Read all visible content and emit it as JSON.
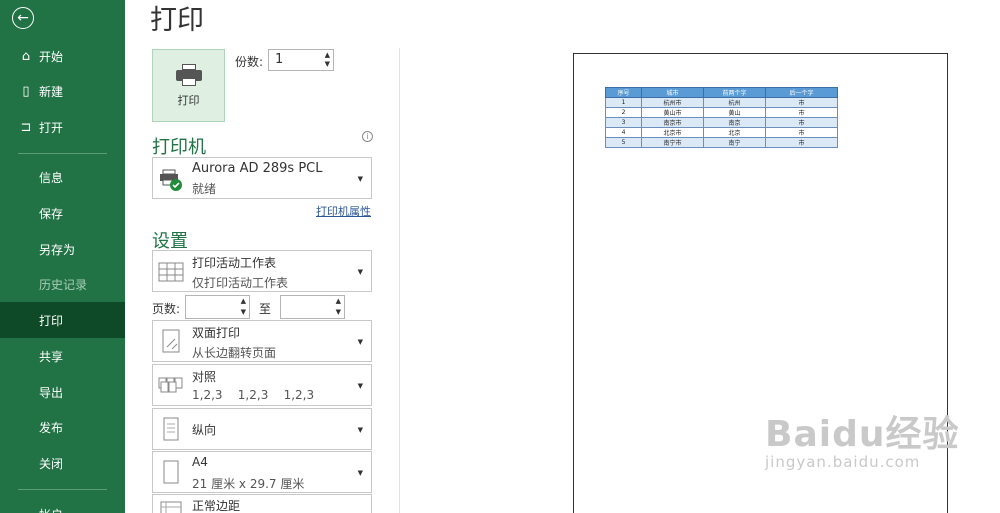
{
  "sidebar": {
    "items": [
      {
        "label": "开始",
        "icon": "home-icon"
      },
      {
        "label": "新建",
        "icon": "new-file-icon"
      },
      {
        "label": "打开",
        "icon": "open-folder-icon"
      },
      {
        "label": "信息"
      },
      {
        "label": "保存"
      },
      {
        "label": "另存为"
      },
      {
        "label": "历史记录",
        "disabled": true
      },
      {
        "label": "打印",
        "active": true
      },
      {
        "label": "共享"
      },
      {
        "label": "导出"
      },
      {
        "label": "发布"
      },
      {
        "label": "关闭"
      },
      {
        "label": "帐户"
      }
    ]
  },
  "page_title": "打印",
  "print_button": {
    "label": "打印"
  },
  "copies": {
    "label": "份数:",
    "value": "1"
  },
  "printer": {
    "heading": "打印机",
    "name": "Aurora AD 289s PCL",
    "status": "就绪",
    "properties_link": "打印机属性"
  },
  "settings": {
    "heading": "设置",
    "scope": {
      "title": "打印活动工作表",
      "subtitle": "仅打印活动工作表"
    },
    "pages_label": "页数:",
    "to_label": "至",
    "duplex": {
      "title": "双面打印",
      "subtitle": "从长边翻转页面"
    },
    "collate": {
      "title": "对照",
      "subtitle": "1,2,3    1,2,3    1,2,3"
    },
    "orientation": {
      "title": "纵向"
    },
    "paper": {
      "title": "A4",
      "subtitle": "21 厘米 x 29.7 厘米"
    },
    "margins": {
      "title": "正常边距"
    }
  },
  "preview": {
    "headers": [
      "序号",
      "城市",
      "前两个字",
      "后一个字"
    ],
    "rows": [
      [
        "1",
        "杭州市",
        "杭州",
        "市"
      ],
      [
        "2",
        "黄山市",
        "黄山",
        "市"
      ],
      [
        "3",
        "南京市",
        "南京",
        "市"
      ],
      [
        "4",
        "北京市",
        "北京",
        "市"
      ],
      [
        "5",
        "南宁市",
        "南宁",
        "市"
      ]
    ]
  },
  "watermark": {
    "line1": "Baidu经验",
    "line2": "jingyan.baidu.com"
  },
  "colors": {
    "accent": "#217346",
    "active": "#0f4a28",
    "link": "#2b5797"
  }
}
